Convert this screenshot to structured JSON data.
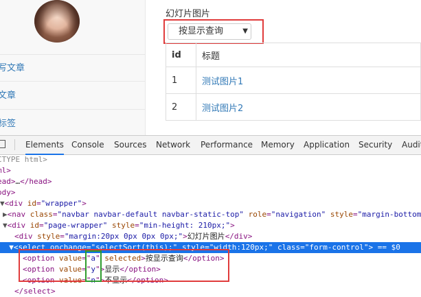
{
  "sidebar": {
    "items": [
      {
        "label": "写文章"
      },
      {
        "label": "文章"
      },
      {
        "label": "标签"
      }
    ]
  },
  "main": {
    "heading": "幻灯片图片",
    "sort_select": {
      "value": "按显示查询",
      "caret": "▼"
    },
    "table": {
      "headers": [
        "id",
        "标题"
      ],
      "rows": [
        {
          "id": "1",
          "title": "测试图片1"
        },
        {
          "id": "2",
          "title": "测试图片2"
        }
      ]
    }
  },
  "devtools": {
    "tabs": [
      "Elements",
      "Console",
      "Sources",
      "Network",
      "Performance",
      "Memory",
      "Application",
      "Security",
      "Audits"
    ],
    "active_tab": "Elements",
    "lines": {
      "l1": "CTYPE html>",
      "l2": "ml>",
      "l3_a": "ead>",
      "l3_b": "…",
      "l3_c": "</head>",
      "l4": "ody>",
      "l5_tag": "<div ",
      "l5_attr": "id",
      "l5_val": "\"wrapper\"",
      "l5_end": ">",
      "l6_tag": "<nav ",
      "l6_a1": "class",
      "l6_v1": "\"navbar navbar-default navbar-static-top\"",
      "l6_a2": "role",
      "l6_v2": "\"navigation\"",
      "l6_a3": "style",
      "l6_v3": "\"margin-bottom: ",
      "l7_tag": "<div ",
      "l7_a1": "id",
      "l7_v1": "\"page-wrapper\"",
      "l7_a2": "style",
      "l7_v2": "\"min-height: 210px;\"",
      "l7_end": ">",
      "l8_tag": "<div ",
      "l8_a1": "style",
      "l8_v1": "\"margin:20px 0px 0px 0px;\"",
      "l8_text": "幻灯片图片",
      "l8_close": "</div>",
      "l9_tag": "<select ",
      "l9_a1": "onchange",
      "l9_v1": "\"selectSort(this);\"",
      "l9_a2": "style",
      "l9_v2": "\"width:120px;\"",
      "l9_a3": "class",
      "l9_v3": "\"form-control\"",
      "l9_end": "> == $0",
      "opt1_val": "a",
      "opt1_extra": "selected",
      "opt1_text": "按显示查询",
      "opt2_val": "y",
      "opt2_text": "显示",
      "opt3_val": "n",
      "opt3_text": "不显示",
      "opt_open": "<option ",
      "opt_attr": "value",
      "opt_close": "</option>",
      "l13": "</select>"
    }
  }
}
